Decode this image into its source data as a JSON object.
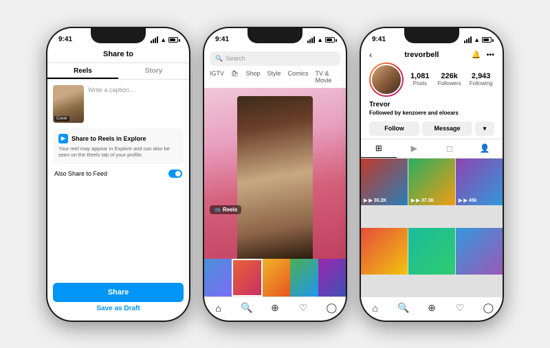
{
  "background": "#f0f0f0",
  "phones": [
    {
      "id": "phone1",
      "statusBar": {
        "time": "9:41"
      },
      "header": {
        "title": "Share to"
      },
      "tabs": [
        {
          "label": "Reels",
          "active": true
        },
        {
          "label": "Story",
          "active": false
        }
      ],
      "caption": {
        "placeholder": "Write a caption..."
      },
      "coverLabel": "Cover",
      "shareToReels": {
        "title": "Share to Reels in Explore",
        "description": "Your reel may appear in Explore and can also be seen on the Reels tab of your profile."
      },
      "alsoShare": {
        "label": "Also Share to Feed"
      },
      "buttons": {
        "share": "Share",
        "draft": "Save as Draft"
      }
    },
    {
      "id": "phone2",
      "statusBar": {
        "time": "9:41"
      },
      "searchPlaceholder": "Search",
      "navTabs": [
        "IGTV",
        "Shop",
        "Style",
        "Comics",
        "TV & Movie"
      ],
      "reelsLabel": "Reels",
      "bottomNav": [
        "home",
        "search",
        "add",
        "heart",
        "person"
      ]
    },
    {
      "id": "phone3",
      "statusBar": {
        "time": "9:41"
      },
      "username": "trevorbell",
      "stats": [
        {
          "num": "1,081",
          "label": "Posts"
        },
        {
          "num": "226k",
          "label": "Followers"
        },
        {
          "num": "2,943",
          "label": "Following"
        }
      ],
      "name": "Trevor",
      "followedBy": "Followed by kenzoere and eloears",
      "buttons": {
        "follow": "Follow",
        "message": "Message",
        "dropdown": "▾"
      },
      "contentTabs": [
        "grid",
        "reels",
        "tagged",
        "person"
      ],
      "gridItems": [
        {
          "count": "▶ 30.2K",
          "color": "v1"
        },
        {
          "count": "▶ 37.3K",
          "color": "v2"
        },
        {
          "count": "▶ 45k",
          "color": "v3"
        },
        {
          "count": "",
          "color": "v4"
        },
        {
          "count": "",
          "color": "v5"
        },
        {
          "count": "",
          "color": "v6"
        }
      ],
      "bottomNav": [
        "home",
        "search",
        "add",
        "heart",
        "person"
      ]
    }
  ]
}
